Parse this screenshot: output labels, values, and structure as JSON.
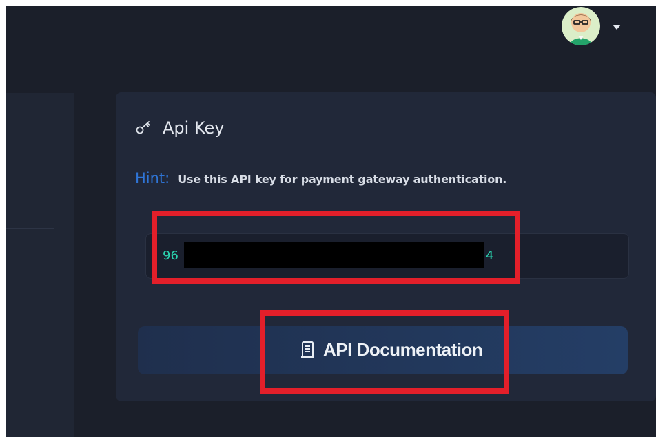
{
  "header": {
    "avatar_icon": "user-avatar",
    "menu_icon": "chevron-down-icon"
  },
  "api_key_card": {
    "title": "Api Key",
    "icon": "key-icon",
    "hint": {
      "label": "Hint:",
      "text": "Use this API key for payment gateway authentication."
    },
    "key": {
      "visible_start": "96",
      "visible_end": "4",
      "redacted": true
    },
    "documentation_button": {
      "label": "API Documentation",
      "icon": "document-icon"
    }
  },
  "colors": {
    "background": "#1b1f2a",
    "card": "#212839",
    "accent_blue": "#2f75d7",
    "key_text": "#2bd4b0",
    "highlight_red": "#e31f2a"
  }
}
